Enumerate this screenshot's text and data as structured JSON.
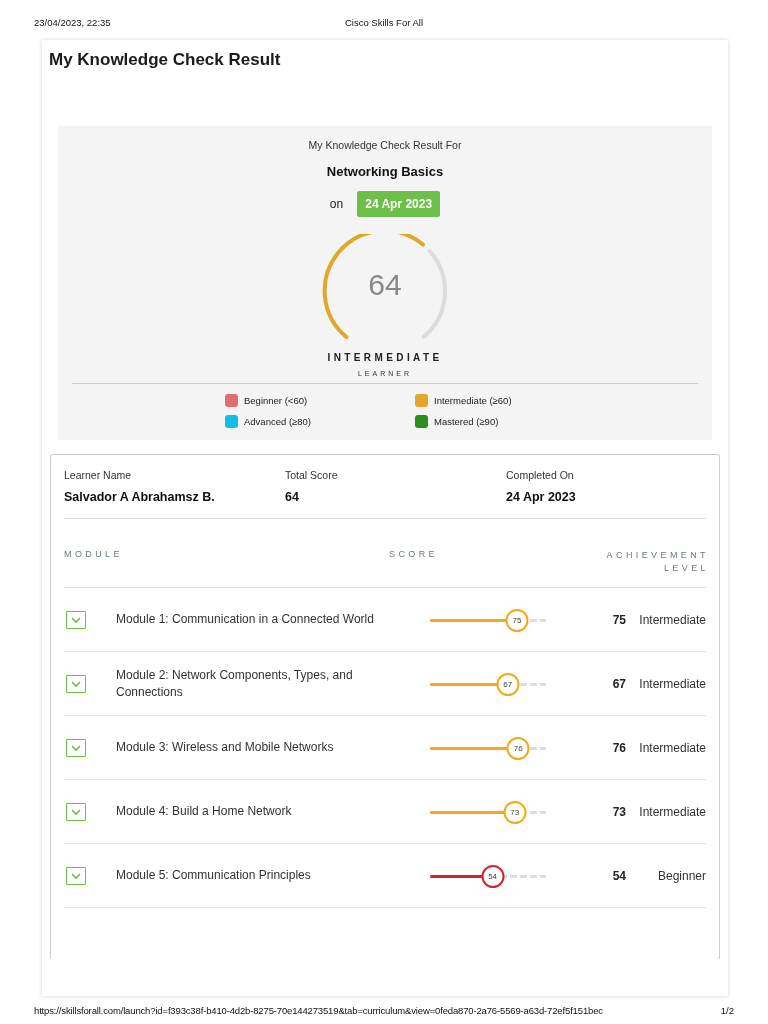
{
  "print_header": {
    "date_time": "23/04/2023, 22:35",
    "site_title": "Cisco Skills For All"
  },
  "page_title": "My Knowledge Check Result",
  "summary": {
    "heading": "My Knowledge Check Result For",
    "course": "Networking Basics",
    "on_label": "on",
    "date": "24 Apr 2023",
    "score": "64",
    "rank": "INTERMEDIATE",
    "rank_sub": "LEARNER",
    "legend": [
      {
        "label": "Beginner (<60)",
        "color": "#de6f6f"
      },
      {
        "label": "Intermediate (≥60)",
        "color": "#e3a62c"
      },
      {
        "label": "Advanced (≥80)",
        "color": "#14bde8"
      },
      {
        "label": "Mastered (≥90)",
        "color": "#2e8b1e"
      }
    ]
  },
  "details": {
    "fields": [
      {
        "label": "Learner Name",
        "value": "Salvador A Abrahamsz B."
      },
      {
        "label": "Total Score",
        "value": "64"
      },
      {
        "label": "Completed On",
        "value": "24 Apr 2023"
      }
    ],
    "columns": [
      "MODULE",
      "SCORE",
      "ACHIEVEMENT LEVEL"
    ],
    "modules": [
      {
        "name": "Module 1: Communication in a Connected World",
        "level": 0.75,
        "badge": "75",
        "score": "75",
        "achievement": "Intermediate",
        "color": "#f2a91e"
      },
      {
        "name": "Module 2: Network Components, Types, and Connections",
        "level": 0.67,
        "badge": "67",
        "score": "67",
        "achievement": "Intermediate",
        "color": "#f2a91e"
      },
      {
        "name": "Module 3: Wireless and Mobile Networks",
        "level": 0.76,
        "badge": "76",
        "score": "76",
        "achievement": "Intermediate",
        "color": "#f2a91e"
      },
      {
        "name": "Module 4: Build a Home Network",
        "level": 0.73,
        "badge": "73",
        "score": "73",
        "achievement": "Intermediate",
        "color": "#f2a91e"
      },
      {
        "name": "Module 5: Communication Principles",
        "level": 0.54,
        "badge": "54",
        "score": "54",
        "achievement": "Beginner",
        "color": "#d2272a"
      }
    ]
  },
  "print_footer": {
    "url": "https://skillsforall.com/launch?id=f393c38f-b410-4d2b-8275-70e144273519&tab=curriculum&view=0feda870-2a76-5569-a63d-72ef5f151bec",
    "page": "1/2"
  }
}
